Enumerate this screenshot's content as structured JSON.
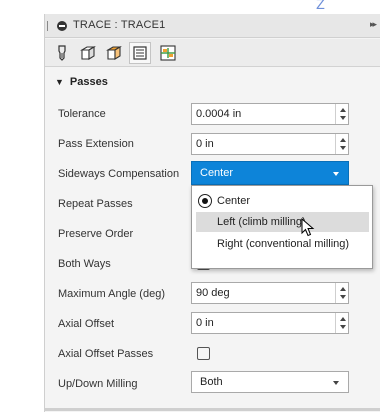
{
  "axis_label": "Z",
  "panel": {
    "title": "TRACE : TRACE1",
    "expand_glyph": "▸▸"
  },
  "tabs": [
    {
      "name": "tool",
      "icon": "tool-icon"
    },
    {
      "name": "geometry",
      "icon": "geometry-icon"
    },
    {
      "name": "heights",
      "icon": "heights-icon"
    },
    {
      "name": "passes",
      "icon": "passes-icon",
      "selected": true
    },
    {
      "name": "linking",
      "icon": "linking-icon"
    }
  ],
  "section": {
    "title": "Passes"
  },
  "fields": {
    "tolerance": {
      "label": "Tolerance",
      "value": "0.0004 in"
    },
    "pass_extension": {
      "label": "Pass Extension",
      "value": "0 in"
    },
    "sideways_compensation": {
      "label": "Sideways Compensation",
      "value": "Center"
    },
    "repeat_passes": {
      "label": "Repeat Passes"
    },
    "preserve_order": {
      "label": "Preserve Order"
    },
    "both_ways": {
      "label": "Both Ways",
      "checked": false
    },
    "maximum_angle": {
      "label": "Maximum Angle (deg)",
      "value": "90 deg"
    },
    "axial_offset": {
      "label": "Axial Offset",
      "value": "0 in"
    },
    "axial_offset_passes": {
      "label": "Axial Offset Passes",
      "checked": false
    },
    "up_down_milling": {
      "label": "Up/Down Milling",
      "value": "Both"
    }
  },
  "dropdown": {
    "options": [
      "Center",
      "Left (climb milling)",
      "Right (conventional milling)"
    ],
    "selected": "Center",
    "hovered": "Left (climb milling)"
  },
  "colors": {
    "accent": "#0d84d9",
    "hover": "#dcdcdc",
    "tab_orange": "#f0a030",
    "tab_green": "#3c9a3c"
  }
}
